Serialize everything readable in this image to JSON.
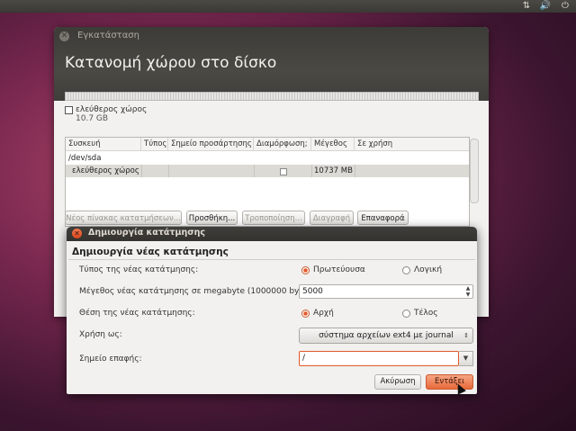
{
  "installer": {
    "title": "Εγκατάσταση",
    "heading": "Κατανομή χώρου στο δίσκο",
    "free_space_label": "ελεύθερος χώρος",
    "free_space_size": "10.7 GB",
    "table": {
      "headers": [
        "Συσκευή",
        "Τύπος",
        "Σημείο προσάρτησης",
        "Διαμόρφωση;",
        "Μέγεθος",
        "Σε χρήση"
      ],
      "rows": [
        {
          "device": "/dev/sda",
          "type": "",
          "mount": "",
          "format": "",
          "size": "",
          "used": ""
        },
        {
          "device": "ελεύθερος χώρος",
          "type": "",
          "mount": "",
          "format": "",
          "size": "10737 MB",
          "used": ""
        }
      ]
    },
    "buttons": {
      "new_table": "Νέος πίνακας κατατμήσεων...",
      "add": "Προσθήκη...",
      "change": "Τροποποίηση...",
      "delete": "Διαγραφή",
      "revert": "Επαναφορά"
    }
  },
  "dialog": {
    "title": "Δημιουργία κατάτμησης",
    "heading": "Δημιουργία νέας κατάτμησης",
    "type_label": "Τύπος της νέας κατάτμησης:",
    "type_primary": "Πρωτεύουσα",
    "type_logical": "Λογική",
    "size_label": "Μέγεθος νέας κατάτμησης σε megabyte (1000000 bytes):",
    "size_value": "5000",
    "location_label": "Θέση της νέας κατάτμησης:",
    "location_beginning": "Αρχή",
    "location_end": "Τέλος",
    "use_as_label": "Χρήση ως:",
    "use_as_value": "σύστημα αρχείων ext4 με journal",
    "mount_label": "Σημείο επαφής:",
    "mount_value": "/",
    "cancel": "Ακύρωση",
    "ok": "Εντάξει"
  },
  "icons": {
    "tray": [
      "network-icon",
      "volume-icon",
      "power-icon"
    ]
  },
  "colors": {
    "accent": "#e2582a",
    "panel": "#3c3b37"
  }
}
